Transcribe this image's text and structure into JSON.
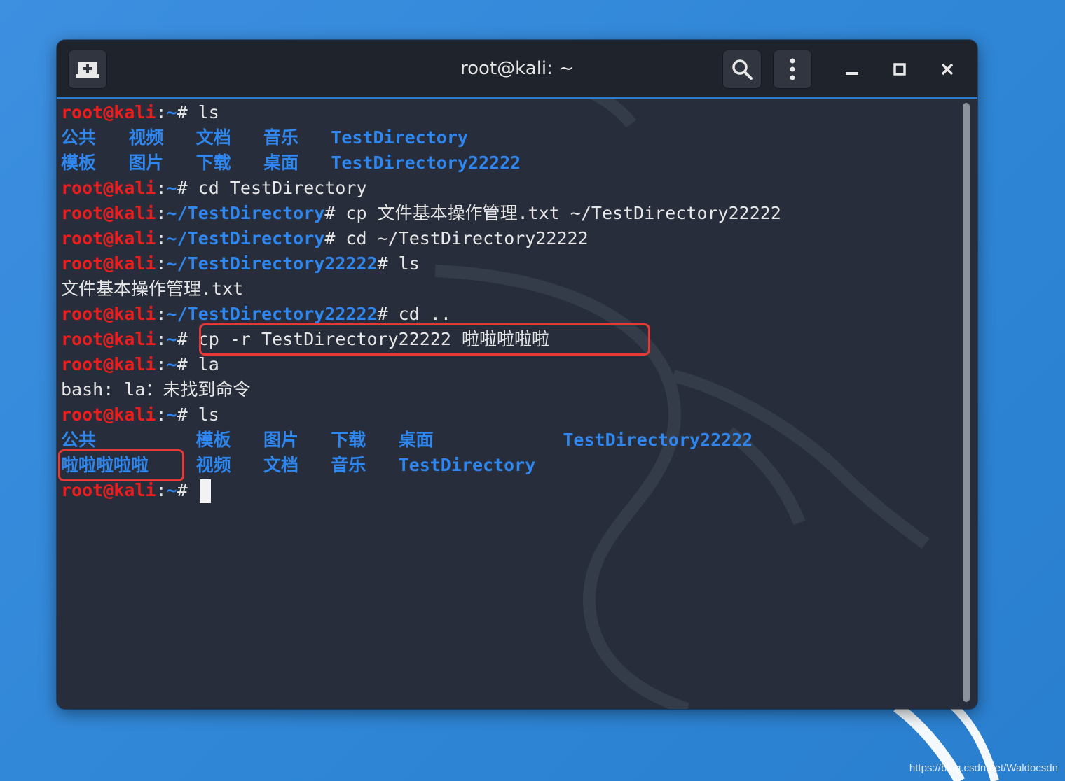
{
  "window": {
    "title": "root@kali: ~"
  },
  "titlebar": {
    "new_tab_icon": "new-tab-icon",
    "search_icon": "search-icon",
    "menu_icon": "kebab-menu-icon",
    "minimize_icon": "minimize-icon",
    "maximize_icon": "maximize-icon",
    "close_icon": "close-icon"
  },
  "colors": {
    "prompt_user": "#ee1c1c",
    "prompt_path": "#2e86ee",
    "directory": "#2e86ee",
    "text": "#e6e6e6",
    "highlight_box": "#e53935",
    "titlebar_accent": "#2e7ccf"
  },
  "terminal": {
    "prompt_user": "root@kali",
    "lines": [
      {
        "kind": "prompt",
        "path": "~",
        "command": "ls"
      },
      {
        "kind": "ls",
        "items": [
          "公共",
          "视频",
          "文档",
          "音乐",
          "TestDirectory"
        ]
      },
      {
        "kind": "ls",
        "items": [
          "模板",
          "图片",
          "下载",
          "桌面",
          "TestDirectory22222"
        ]
      },
      {
        "kind": "prompt",
        "path": "~",
        "command": "cd TestDirectory"
      },
      {
        "kind": "prompt",
        "path": "~/TestDirectory",
        "command": "cp 文件基本操作管理.txt ~/TestDirectory22222"
      },
      {
        "kind": "prompt",
        "path": "~/TestDirectory",
        "command": "cd ~/TestDirectory22222"
      },
      {
        "kind": "prompt",
        "path": "~/TestDirectory22222",
        "command": "ls"
      },
      {
        "kind": "output",
        "text": "文件基本操作管理.txt"
      },
      {
        "kind": "prompt",
        "path": "~/TestDirectory22222",
        "command": "cd .."
      },
      {
        "kind": "prompt",
        "path": "~",
        "command": "cp -r TestDirectory22222 啦啦啦啦啦",
        "highlighted": true
      },
      {
        "kind": "prompt",
        "path": "~",
        "command": "la"
      },
      {
        "kind": "output",
        "text": "bash: la：未找到命令"
      },
      {
        "kind": "prompt",
        "path": "~",
        "command": "ls"
      },
      {
        "kind": "ls",
        "items": [
          "公共",
          "模板",
          "图片",
          "下载",
          "桌面",
          "TestDirectory22222"
        ]
      },
      {
        "kind": "ls",
        "items": [
          "啦啦啦啦啦",
          "视频",
          "文档",
          "音乐",
          "TestDirectory"
        ],
        "highlight_first": true
      },
      {
        "kind": "prompt",
        "path": "~",
        "command": "",
        "cursor": true
      }
    ]
  },
  "watermark": "https://blog.csdn.net/Waldocsdn"
}
